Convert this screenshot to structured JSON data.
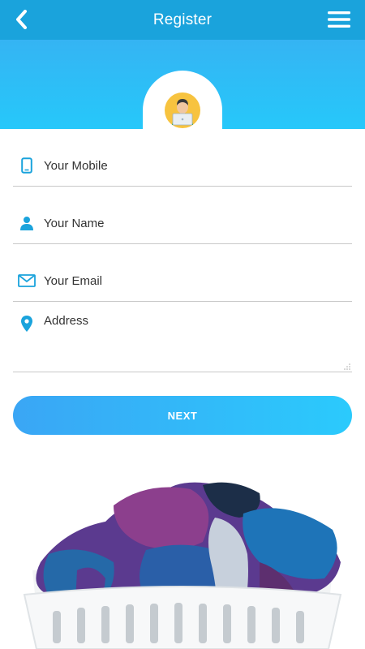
{
  "header": {
    "title": "Register",
    "back_icon": "chevron-left-icon",
    "menu_icon": "hamburger-menu-icon"
  },
  "hero": {
    "avatar_icon": "user-avatar-icon"
  },
  "form": {
    "mobile": {
      "placeholder": "Your Mobile",
      "icon": "phone-icon"
    },
    "name": {
      "placeholder": "Your Name",
      "icon": "person-icon"
    },
    "email": {
      "placeholder": "Your Email",
      "icon": "mail-icon"
    },
    "address": {
      "placeholder": "Address",
      "icon": "location-pin-icon"
    }
  },
  "next_label": "NEXT",
  "image": {
    "subject": "laundry-basket-image"
  },
  "colors": {
    "appbar": "#1aa3dc",
    "hero": "#35b4f3",
    "accent": "#2bcafc",
    "icon": "#1aa3dc"
  }
}
